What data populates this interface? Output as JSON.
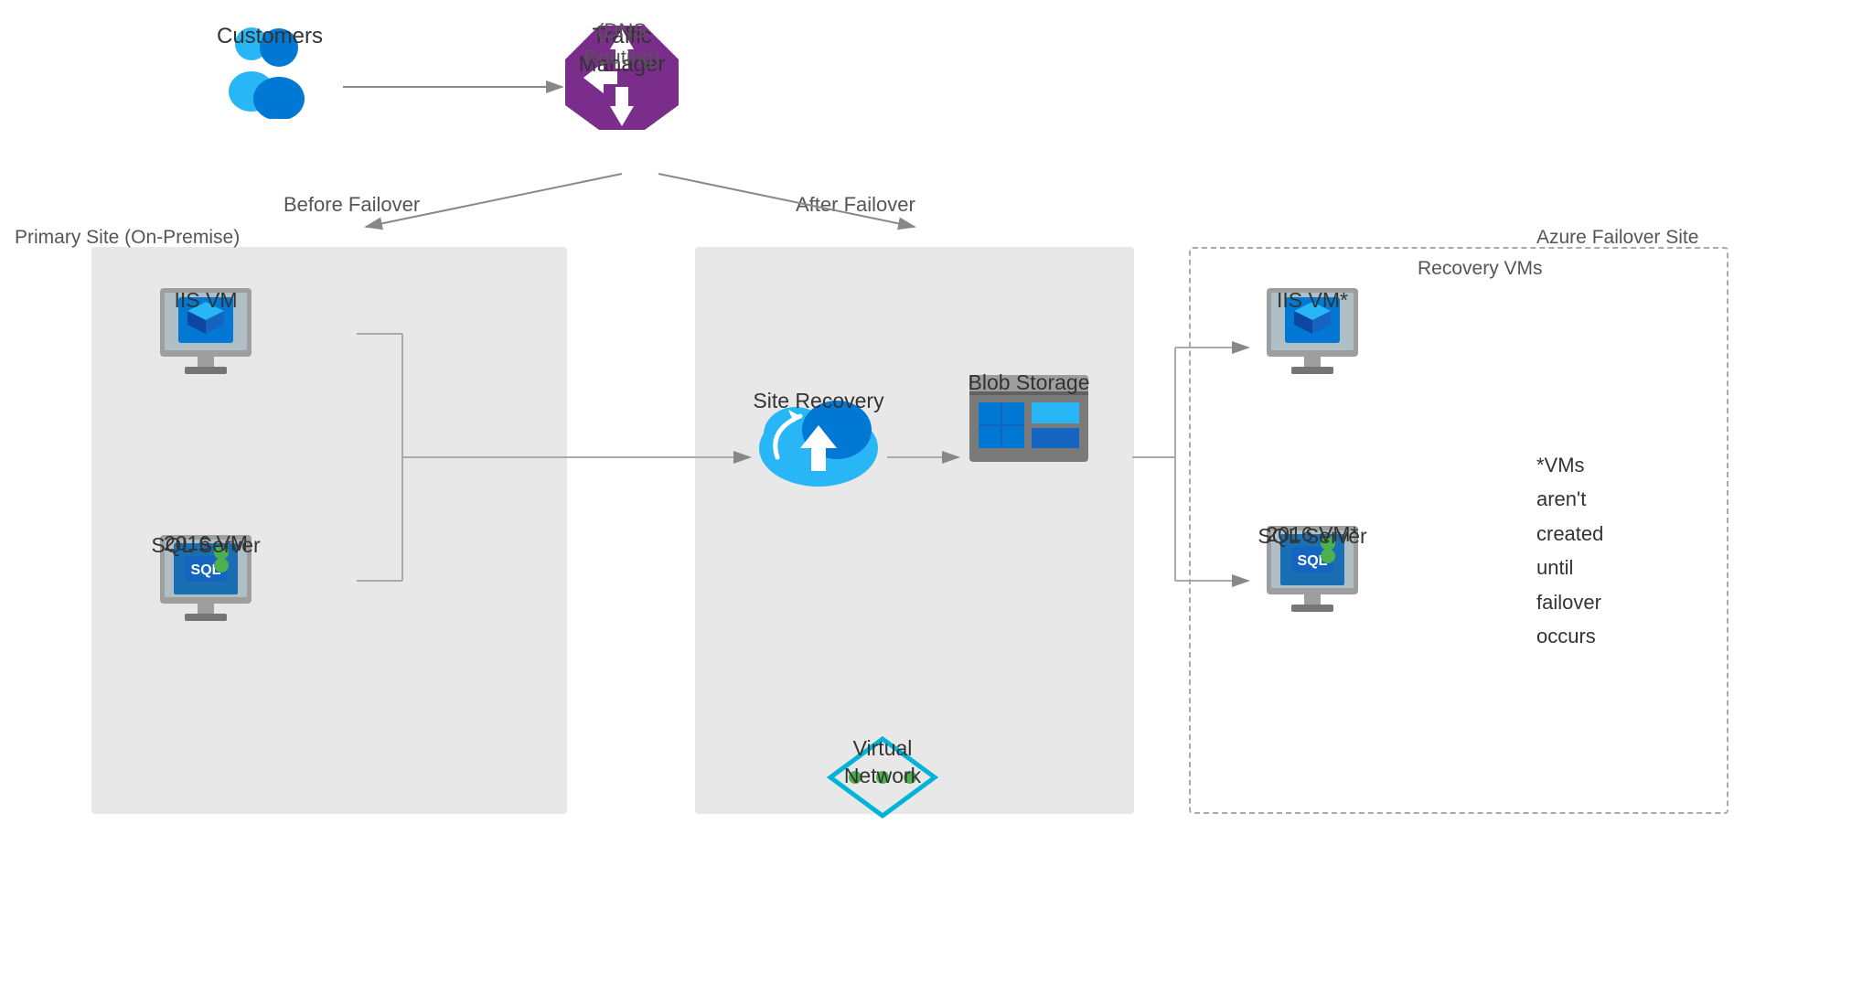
{
  "labels": {
    "customers": "Customers",
    "traffic_manager": "Traffic Manager\n(DNS Routing)",
    "traffic_manager_line1": "Traffic Manager",
    "traffic_manager_line2": "(DNS Routing)",
    "primary_site": "Primary Site (On-Premise)",
    "azure_failover": "Azure Failover Site",
    "before_failover": "Before Failover",
    "after_failover": "After Failover",
    "iis_vm": "IIS VM",
    "iis_vm_recovery": "IIS VM*",
    "sql_vm": "SQL Server\n2016 VM",
    "sql_vm_line1": "SQL Server",
    "sql_vm_line2": "2016 VM",
    "sql_vm_recovery_line1": "SQL Server",
    "sql_vm_recovery_line2": "2016 VM*",
    "site_recovery": "Site Recovery",
    "blob_storage": "Blob Storage",
    "virtual_network": "Virtual Network",
    "recovery_vms": "Recovery VMs",
    "note": "*VMs\naren't\ncreated\nuntil\nfailover\noccurs"
  },
  "colors": {
    "primary_zone_bg": "#e8e8e8",
    "azure_zone_bg": "#e8e8e8",
    "recovery_zone_border": "#aaa",
    "arrow_color": "#888",
    "text_color": "#333",
    "iis_blue": "#0078d4",
    "sql_blue": "#1a6fb3",
    "cloud_blue": "#0091ea",
    "traffic_mgr_purple": "#6b2fa0",
    "blob_gray": "#666",
    "network_teal": "#00b4d8"
  }
}
